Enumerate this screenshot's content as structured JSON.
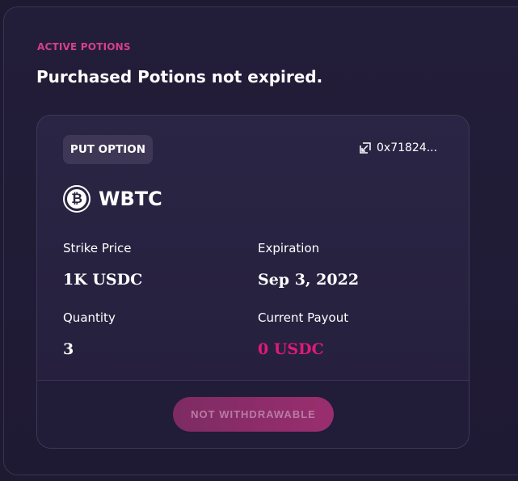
{
  "section": {
    "eyebrow": "ACTIVE POTIONS",
    "heading": "Purchased Potions not expired."
  },
  "card": {
    "badge": "PUT OPTION",
    "address": "0x71824...",
    "asset": {
      "name": "WBTC",
      "icon": "bitcoin-icon",
      "glyph": "₿"
    },
    "fields": {
      "strike_label": "Strike Price",
      "strike_value": "1K USDC",
      "expiration_label": "Expiration",
      "expiration_value": "Sep 3, 2022",
      "quantity_label": "Quantity",
      "quantity_value": "3",
      "payout_label": "Current Payout",
      "payout_value": "0 USDC"
    },
    "action_label": "NOT WITHDRAWABLE"
  },
  "colors": {
    "accent": "#d6408a",
    "payout": "#e0197a",
    "background": "#1e1a32"
  }
}
